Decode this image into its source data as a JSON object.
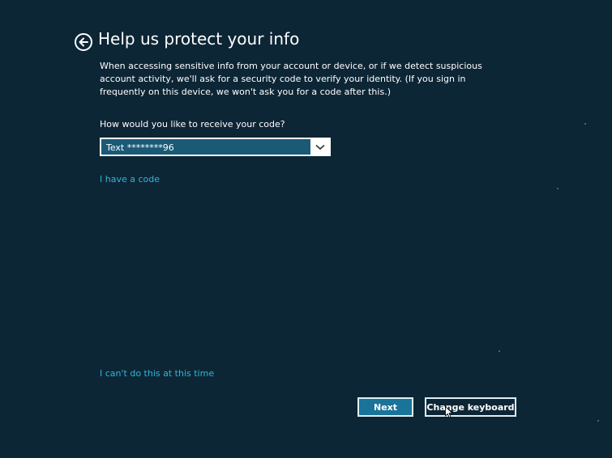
{
  "page": {
    "title": "Help us protect your info",
    "description": "When accessing sensitive info from your account or device, or if we detect suspicious account activity, we'll ask for a security code to verify your identity. (If you sign in frequently on this device, we won't ask you for a code after this.)"
  },
  "form": {
    "question": "How would you like to receive your code?",
    "method_selected": "Text ********96"
  },
  "links": {
    "have_code": "I have a code",
    "cant_do": "I can't do this at this time"
  },
  "buttons": {
    "next": "Next",
    "change_keyboard": "Change keyboard"
  },
  "colors": {
    "background": "#0d2636",
    "accent": "#2fb6d8",
    "selected": "#1a5a76",
    "primary_button": "#1a7398"
  },
  "icons": {
    "back": "back-arrow-icon",
    "dropdown": "chevron-down-icon",
    "cursor": "mouse-cursor-icon"
  }
}
